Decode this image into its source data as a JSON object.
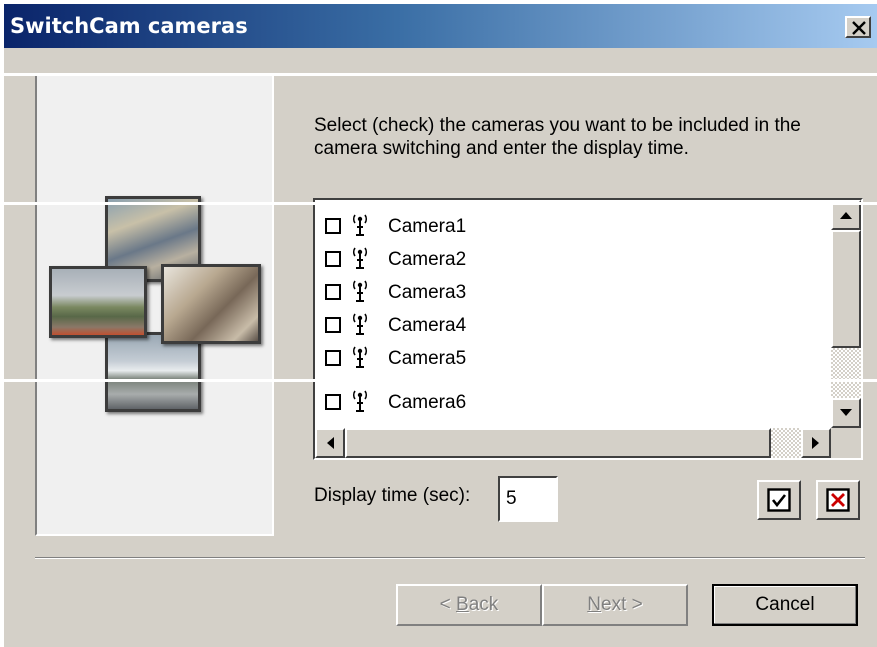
{
  "window": {
    "title": "SwitchCam cameras",
    "close_icon": "close-x-icon"
  },
  "instructions": "Select (check) the cameras you want to be included in the camera switching and enter the display time.",
  "cameras": [
    {
      "label": "Camera1",
      "checked": false
    },
    {
      "label": "Camera2",
      "checked": false
    },
    {
      "label": "Camera3",
      "checked": false
    },
    {
      "label": "Camera4",
      "checked": false
    },
    {
      "label": "Camera5",
      "checked": false
    },
    {
      "label": "Camera6",
      "checked": false
    }
  ],
  "display_time": {
    "label": "Display time (sec):",
    "value": "5"
  },
  "select_all_icon": "check-all-icon",
  "clear_all_icon": "uncheck-all-icon",
  "buttons": {
    "back": {
      "prefix": "< ",
      "accel": "B",
      "rest": "ack"
    },
    "next": {
      "accel": "N",
      "rest": "ext >"
    },
    "cancel": "Cancel"
  },
  "colors": {
    "titlebar_start": "#0a246a",
    "titlebar_end": "#a6caf0",
    "dialog_face": "#d4d0c8",
    "clear_icon_red": "#cc0000"
  }
}
